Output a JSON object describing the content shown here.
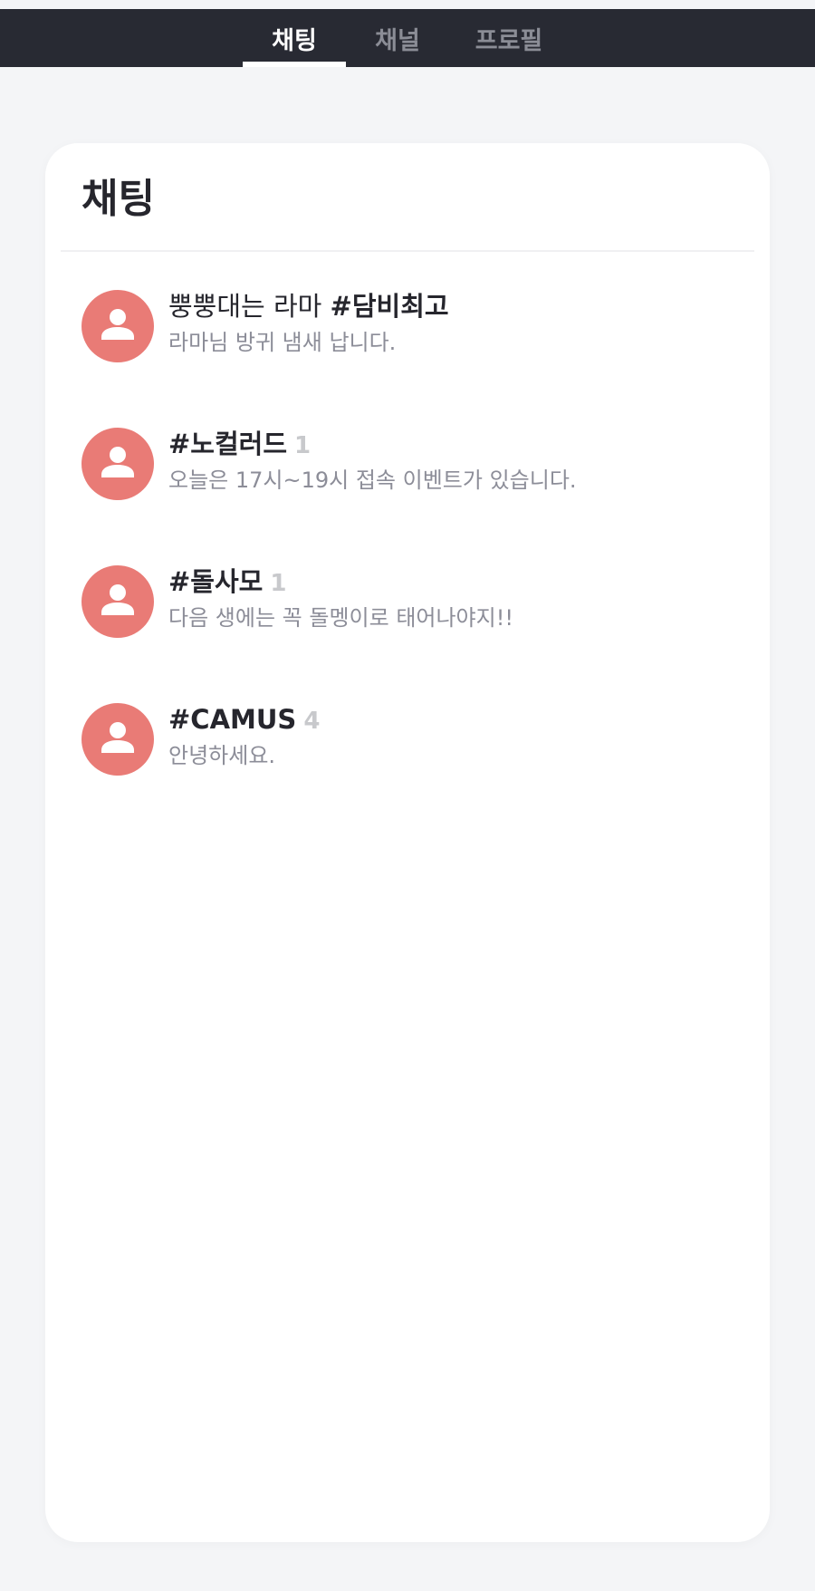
{
  "nav": {
    "tabs": [
      {
        "label": "채팅",
        "active": true
      },
      {
        "label": "채널",
        "active": false
      },
      {
        "label": "프로필",
        "active": false
      }
    ]
  },
  "main": {
    "title": "채팅",
    "chats": [
      {
        "name_plain": "뿡뿡대는 라마 ",
        "name_bold": "#담비최고",
        "unread": "",
        "preview": "라마님 방귀 냄새 납니다.",
        "avatar_icon": "user-avatar-icon"
      },
      {
        "name_plain": "",
        "name_bold": "#노컬러드",
        "unread": "1",
        "preview": "오늘은 17시~19시 접속 이벤트가 있습니다.",
        "avatar_icon": "user-avatar-icon"
      },
      {
        "name_plain": "",
        "name_bold": "#돌사모",
        "unread": "1",
        "preview": "다음 생에는 꼭 돌멩이로 태어나야지!!",
        "avatar_icon": "user-avatar-icon"
      },
      {
        "name_plain": "",
        "name_bold": "#CAMUS",
        "unread": "4",
        "preview": "안녕하세요.",
        "avatar_icon": "user-avatar-icon"
      }
    ]
  },
  "colors": {
    "navbar": "#282a33",
    "avatar": "#e97b76",
    "unread": "#c8c9cc",
    "preview": "#8c8d98"
  }
}
